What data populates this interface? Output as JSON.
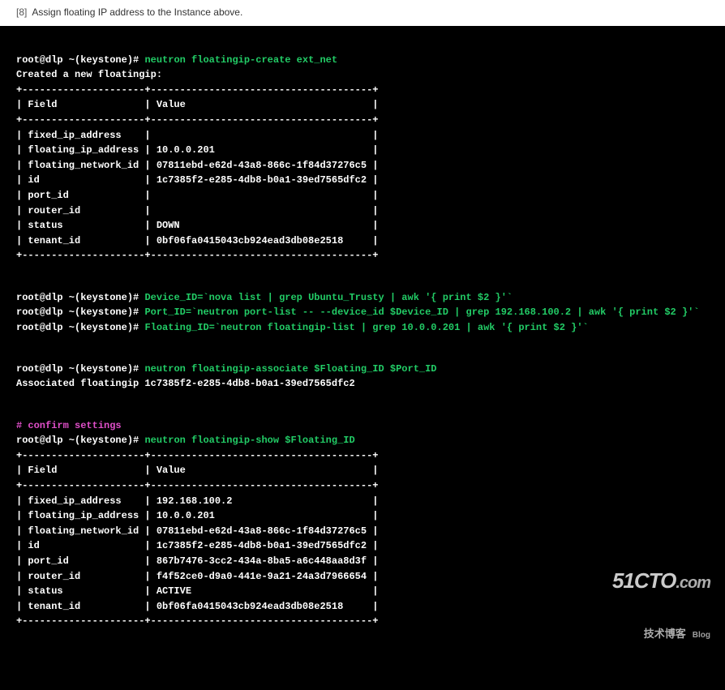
{
  "step": {
    "num": "[8]",
    "text": "Assign floating IP address to the Instance above."
  },
  "prompt": "root@dlp ~(keystone)#",
  "cmds": {
    "create": "neutron floatingip-create ext_net",
    "device_id": "Device_ID=`nova list | grep Ubuntu_Trusty | awk '{ print $2 }'`",
    "port_id": "Port_ID=`neutron port-list -- --device_id $Device_ID | grep 192.168.100.2 | awk '{ print $2 }'`",
    "floating_id": "Floating_ID=`neutron floatingip-list | grep 10.0.0.201 | awk '{ print $2 }'`",
    "associate": "neutron floatingip-associate $Floating_ID $Port_ID",
    "show": "neutron floatingip-show $Floating_ID"
  },
  "out": {
    "created": "Created a new floatingip:",
    "associated": "Associated floatingip 1c7385f2-e285-4db8-b0a1-39ed7565dfc2",
    "confirm": "# confirm settings"
  },
  "table1": {
    "border": "+---------------------+--------------------------------------+",
    "header": "| Field               | Value                                |",
    "rows": [
      "| fixed_ip_address    |                                      |",
      "| floating_ip_address | 10.0.0.201                           |",
      "| floating_network_id | 07811ebd-e62d-43a8-866c-1f84d37276c5 |",
      "| id                  | 1c7385f2-e285-4db8-b0a1-39ed7565dfc2 |",
      "| port_id             |                                      |",
      "| router_id           |                                      |",
      "| status              | DOWN                                 |",
      "| tenant_id           | 0bf06fa0415043cb924ead3db08e2518     |"
    ]
  },
  "table2": {
    "border": "+---------------------+--------------------------------------+",
    "header": "| Field               | Value                                |",
    "rows": [
      "| fixed_ip_address    | 192.168.100.2                        |",
      "| floating_ip_address | 10.0.0.201                           |",
      "| floating_network_id | 07811ebd-e62d-43a8-866c-1f84d37276c5 |",
      "| id                  | 1c7385f2-e285-4db8-b0a1-39ed7565dfc2 |",
      "| port_id             | 867b7476-3cc2-434a-8ba5-a6c448aa8d3f |",
      "| router_id           | f4f52ce0-d9a0-441e-9a21-24a3d7966654 |",
      "| status              | ACTIVE                               |",
      "| tenant_id           | 0bf06fa0415043cb924ead3db08e2518     |"
    ]
  },
  "watermark": {
    "main1": "51CTO",
    "main2": ".com",
    "sub": "技术博客",
    "blog": "Blog"
  }
}
